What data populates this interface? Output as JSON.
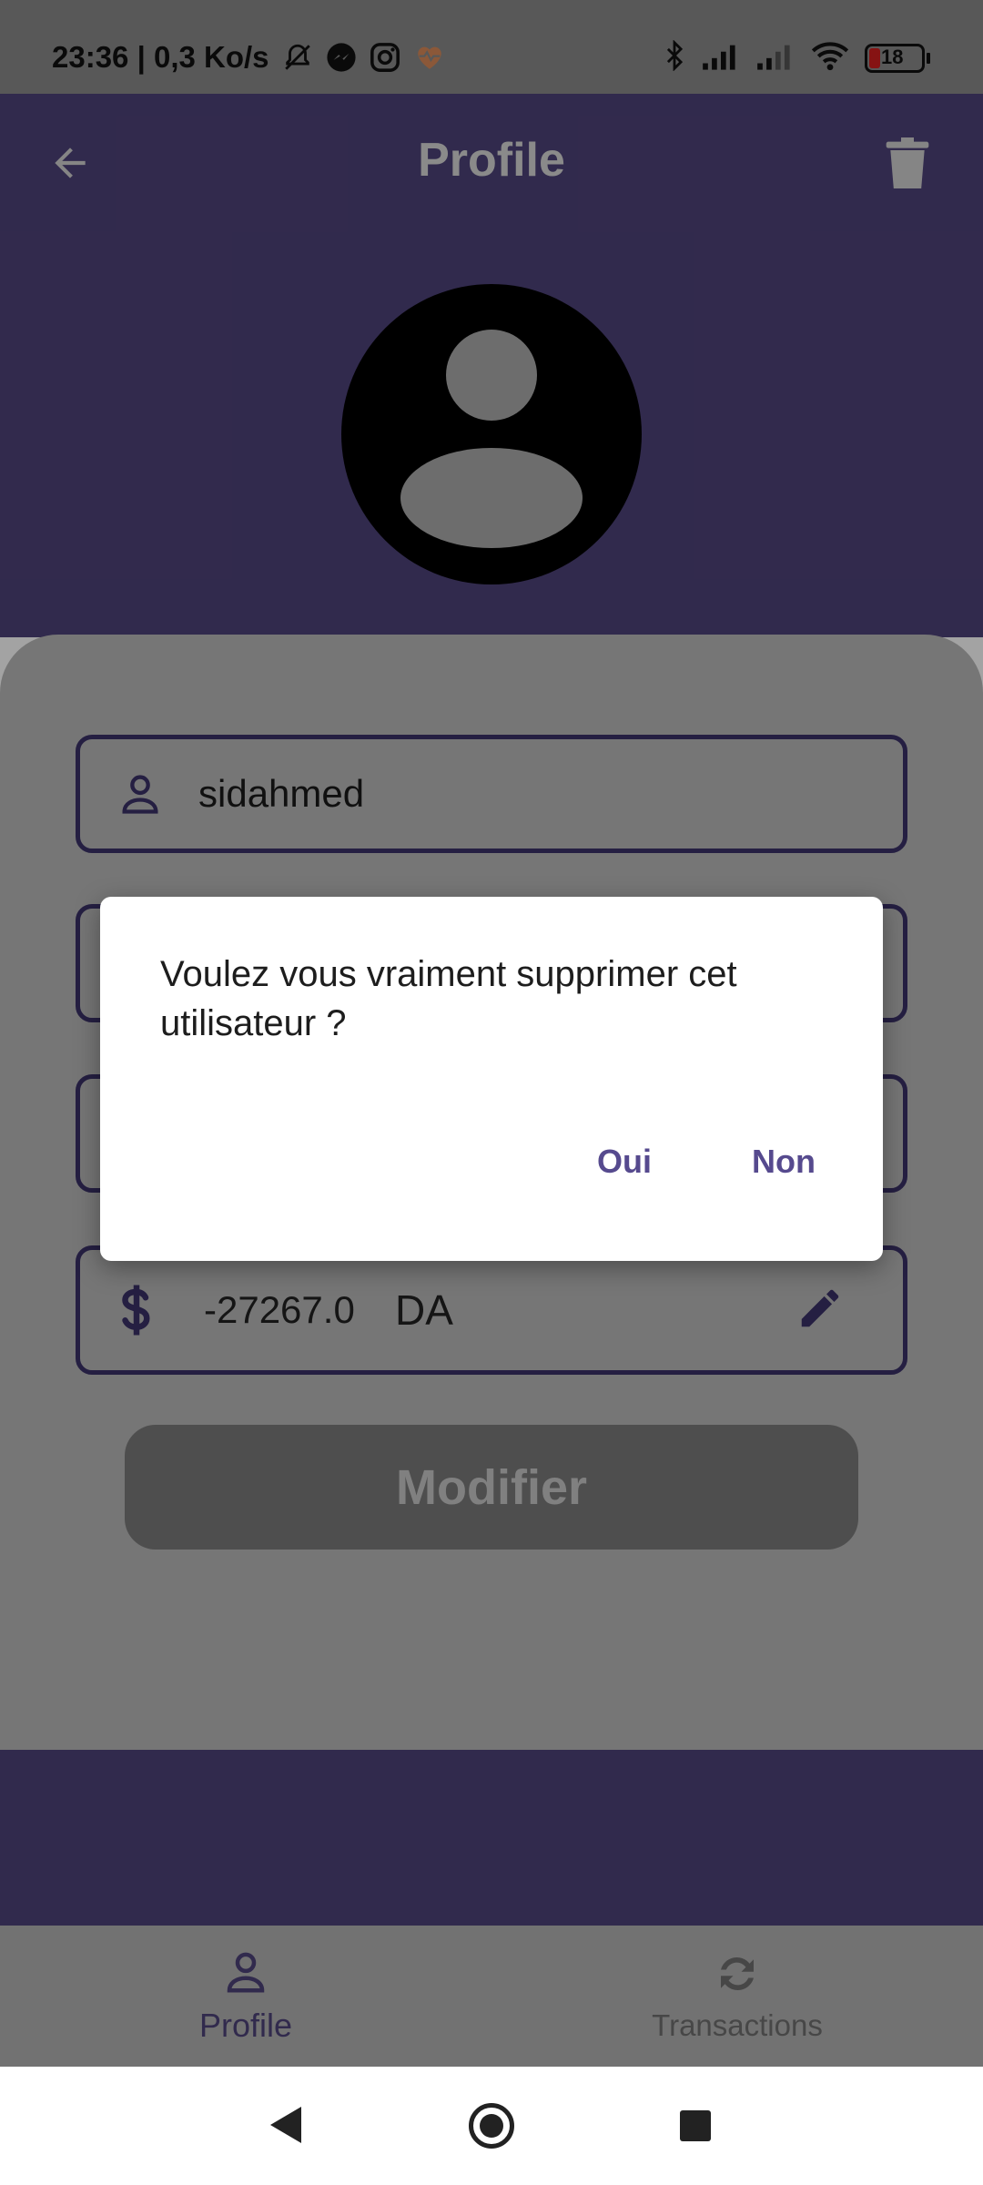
{
  "status_bar": {
    "time_speed": "23:36 | 0,3 Ko/s",
    "battery": "18"
  },
  "appbar": {
    "title": "Profile"
  },
  "form": {
    "username": "sidahmed",
    "balance_amount": "-27267.0",
    "balance_currency": "DA",
    "modify_label": "Modifier"
  },
  "dialog": {
    "message": "Voulez vous vraiment supprimer cet utilisateur ?",
    "yes_label": "Oui",
    "no_label": "Non"
  },
  "bottom_nav": {
    "items": [
      {
        "label": "Profile",
        "icon": "person-icon",
        "active": true
      },
      {
        "label": "Transactions",
        "icon": "sync-icon",
        "active": false
      }
    ]
  },
  "colors": {
    "primary": "#4e4279",
    "accent": "#564a8e"
  }
}
